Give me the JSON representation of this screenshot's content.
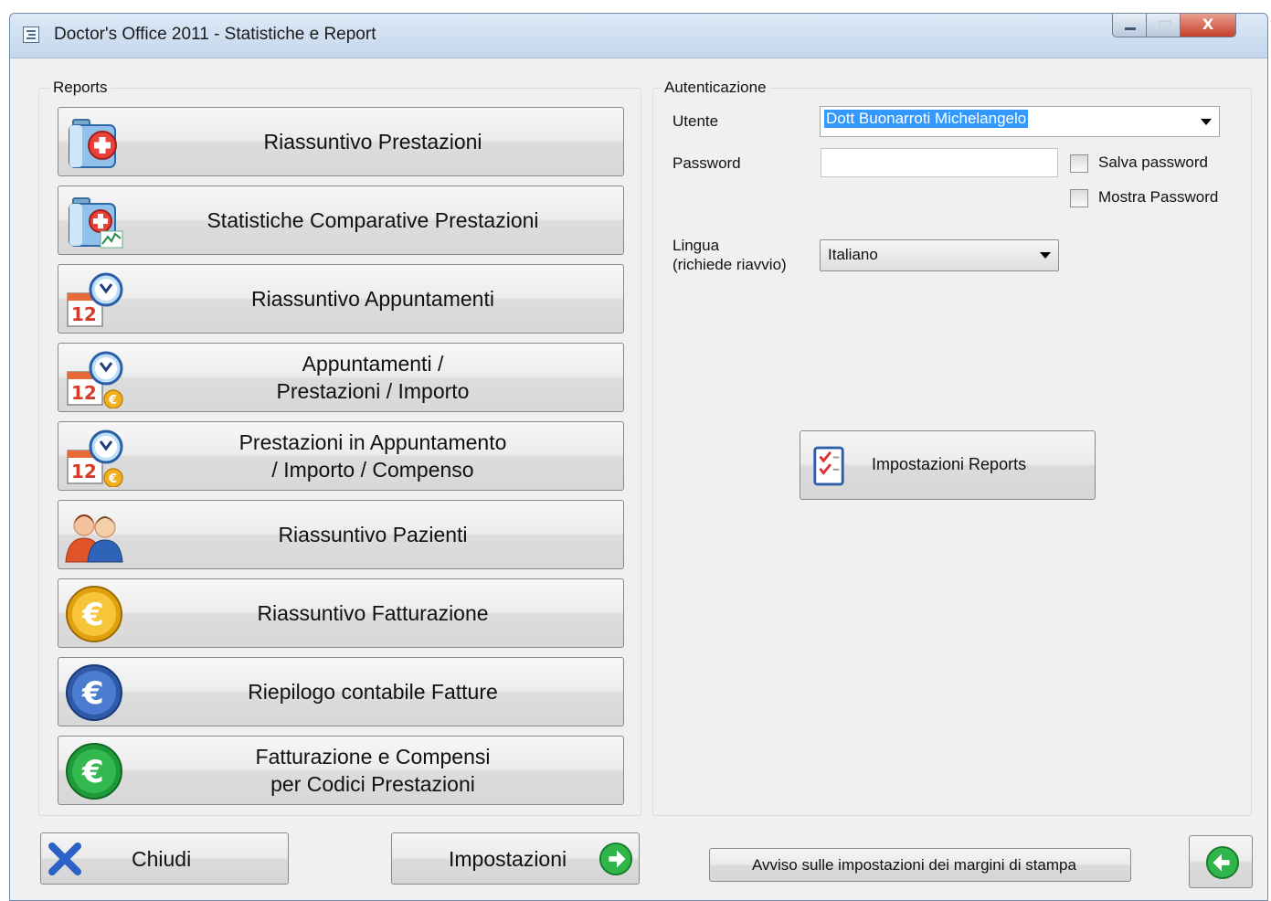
{
  "window": {
    "title": "Doctor's Office 2011 - Statistiche e Report",
    "controls": {
      "close_glyph": "X"
    }
  },
  "reports": {
    "group_label": "Reports",
    "buttons": [
      {
        "label": "Riassuntivo Prestazioni",
        "icon": "medical-kit-icon"
      },
      {
        "label": "Statistiche Comparative Prestazioni",
        "icon": "medical-kit-chart-icon"
      },
      {
        "label": "Riassuntivo Appuntamenti",
        "icon": "calendar-clock-icon"
      },
      {
        "label": "Appuntamenti /\nPrestazioni / Importo",
        "icon": "calendar-clock-euro-icon"
      },
      {
        "label": "Prestazioni in Appuntamento\n/ Importo / Compenso",
        "icon": "calendar-clock-euro-icon"
      },
      {
        "label": "Riassuntivo Pazienti",
        "icon": "patients-icon"
      },
      {
        "label": "Riassuntivo Fatturazione",
        "icon": "euro-gold-icon"
      },
      {
        "label": "Riepilogo contabile Fatture",
        "icon": "euro-blue-icon"
      },
      {
        "label": "Fatturazione e Compensi\nper Codici Prestazioni",
        "icon": "euro-green-icon"
      }
    ]
  },
  "auth": {
    "group_label": "Autenticazione",
    "user_label": "Utente",
    "user_value": "Dott Buonarroti Michelangelo",
    "password_label": "Password",
    "password_value": "",
    "save_password_label": "Salva password",
    "show_password_label": "Mostra Password",
    "language_label_1": "Lingua",
    "language_label_2": "(richiede riavvio)",
    "language_value": "Italiano"
  },
  "settings_reports_button": "Impostazioni Reports",
  "footer": {
    "close_label": "Chiudi",
    "settings_label": "Impostazioni",
    "margins_warning_label": "Avviso sulle impostazioni dei margini di stampa"
  },
  "colors": {
    "selection": "#3399ff",
    "close_button": "#c6402b",
    "arrow_green": "#2fb54a"
  }
}
